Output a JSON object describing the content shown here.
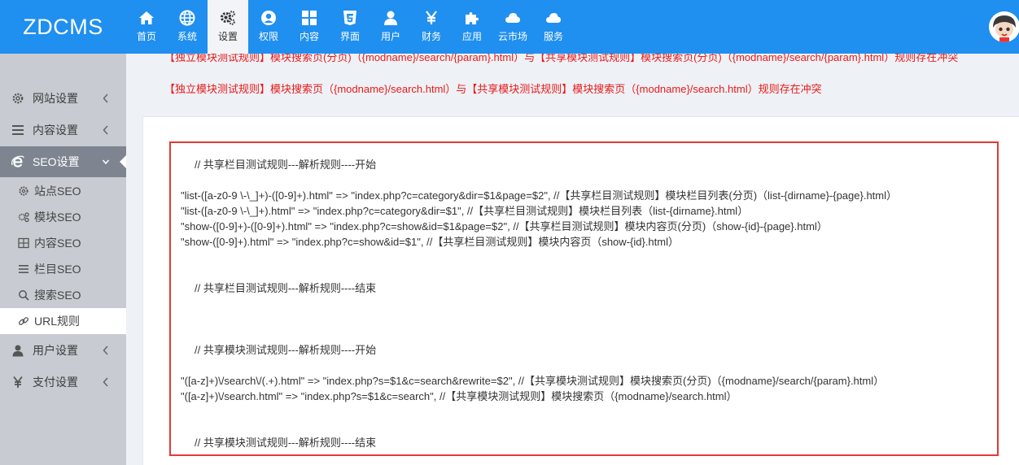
{
  "brand": "ZDCMS",
  "nav": [
    {
      "label": "首页",
      "icon": "home-icon"
    },
    {
      "label": "系统",
      "icon": "globe-icon"
    },
    {
      "label": "设置",
      "icon": "gears-icon",
      "active": true
    },
    {
      "label": "权限",
      "icon": "user-circle-icon"
    },
    {
      "label": "内容",
      "icon": "grid-icon"
    },
    {
      "label": "界面",
      "icon": "html5-icon"
    },
    {
      "label": "用户",
      "icon": "user-icon"
    },
    {
      "label": "财务",
      "icon": "yen-icon"
    },
    {
      "label": "应用",
      "icon": "puzzle-icon"
    },
    {
      "label": "云市场",
      "icon": "cloud-icon"
    },
    {
      "label": "服务",
      "icon": "cloud-service-icon"
    }
  ],
  "sidebar": {
    "items": [
      {
        "label": "网站设置",
        "icon": "gear-icon"
      },
      {
        "label": "内容设置",
        "icon": "list-icon"
      },
      {
        "label": "SEO设置",
        "icon": "ie-icon",
        "open": true
      },
      {
        "label": "用户设置",
        "icon": "user-icon"
      },
      {
        "label": "支付设置",
        "icon": "yen-icon"
      }
    ],
    "sub_items": [
      {
        "label": "站点SEO",
        "icon": "gear-icon"
      },
      {
        "label": "模块SEO",
        "icon": "gears-icon"
      },
      {
        "label": "内容SEO",
        "icon": "table-icon"
      },
      {
        "label": "栏目SEO",
        "icon": "list-icon"
      },
      {
        "label": "搜索SEO",
        "icon": "search-icon"
      },
      {
        "label": "URL规则",
        "icon": "link-icon",
        "active": true
      }
    ]
  },
  "conflicts": [
    "【独立模块测试规则】模块搜索页(分页)（{modname}/search/{param}.html）与【共享模块测试规则】模块搜索页(分页)（{modname}/search/{param}.html）规则存在冲突",
    "【独立模块测试规则】模块搜索页（{modname}/search.html）与【共享模块测试规则】模块搜索页（{modname}/search.html）规则存在冲突"
  ],
  "code": {
    "cat_start": "// 共享栏目测试规则---解析规则----开始",
    "cat_rules": [
      "\"list-([a-z0-9 \\-\\_]+)-([0-9]+).html\" => \"index.php?c=category&dir=$1&page=$2\",  //【共享栏目测试规则】模块栏目列表(分页)（list-{dirname}-{page}.html）",
      "\"list-([a-z0-9 \\-\\_]+).html\" => \"index.php?c=category&dir=$1\",  //【共享栏目测试规则】模块栏目列表（list-{dirname}.html）",
      "\"show-([0-9]+)-([0-9]+).html\" => \"index.php?c=show&id=$1&page=$2\",  //【共享栏目测试规则】模块内容页(分页)（show-{id}-{page}.html）",
      "\"show-([0-9]+).html\" => \"index.php?c=show&id=$1\",  //【共享栏目测试规则】模块内容页（show-{id}.html）"
    ],
    "cat_end": "// 共享栏目测试规则---解析规则----结束",
    "mod_start": "// 共享模块测试规则---解析规则----开始",
    "mod_rules": [
      "\"([a-z]+)\\/search\\/(.+).html\" => \"index.php?s=$1&c=search&rewrite=$2\",  //【共享模块测试规则】模块搜索页(分页)（{modname}/search/{param}.html）",
      "\"([a-z]+)\\/search.html\" => \"index.php?s=$1&c=search\",  //【共享模块测试规则】模块搜索页（{modname}/search.html）"
    ],
    "mod_end": "// 共享模块测试规则---解析规则----结束"
  },
  "colors": {
    "topbar": "#1f8ff0",
    "sidebar": "#c8ccd2",
    "sidebar_open": "#7e8590",
    "conflict_text": "#e61b1b",
    "highlight_border": "#e53935"
  }
}
